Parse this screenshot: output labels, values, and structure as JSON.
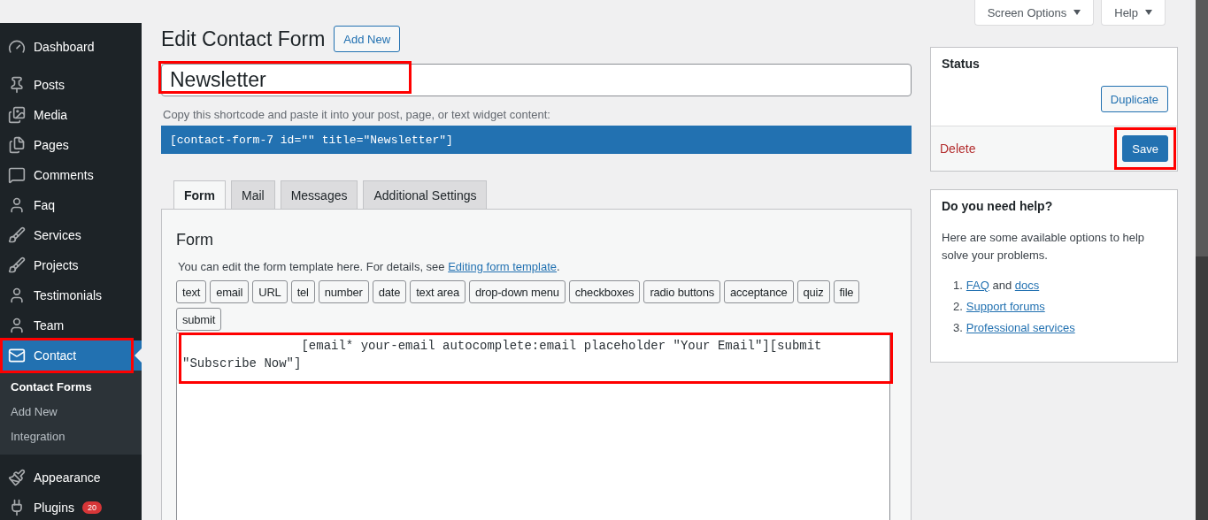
{
  "sidebar": {
    "menu_groups": [
      [
        {
          "label": "Dashboard",
          "selected": false
        }
      ],
      [
        {
          "label": "Posts",
          "selected": false
        },
        {
          "label": "Media",
          "selected": false
        },
        {
          "label": "Pages",
          "selected": false
        },
        {
          "label": "Comments",
          "selected": false
        },
        {
          "label": "Faq",
          "selected": false
        },
        {
          "label": "Services",
          "selected": false
        },
        {
          "label": "Projects",
          "selected": false
        },
        {
          "label": "Testimonials",
          "selected": false
        },
        {
          "label": "Team",
          "selected": false
        },
        {
          "label": "Contact",
          "selected": true,
          "highlighted": true,
          "submenu": [
            {
              "label": "Contact Forms",
              "selected": true
            },
            {
              "label": "Add New",
              "selected": false
            },
            {
              "label": "Integration",
              "selected": false
            }
          ]
        }
      ],
      [
        {
          "label": "Appearance",
          "selected": false
        },
        {
          "label": "Plugins",
          "selected": false,
          "badge": "20"
        }
      ]
    ]
  },
  "screen_meta": {
    "buttons": [
      "Screen Options",
      "Help"
    ]
  },
  "page_title": "Edit Contact Form",
  "add_new_button": "Add New",
  "title_field": {
    "value": "Newsletter",
    "highlighted": true
  },
  "shortcode": {
    "description": "Copy this shortcode and paste it into your post, page, or text widget content:",
    "code": "[contact-form-7 id=\"\" title=\"Newsletter\"]"
  },
  "tabs": [
    {
      "label": "Form",
      "selected": true
    },
    {
      "label": "Mail",
      "selected": false
    },
    {
      "label": "Messages",
      "selected": false
    },
    {
      "label": "Additional Settings",
      "selected": false
    }
  ],
  "form_panel": {
    "heading": "Form",
    "intro": "You can edit the form template here. For details, see ",
    "intro_link": "Editing form template",
    "intro_end": ".",
    "tag_buttons": [
      "text",
      "email",
      "URL",
      "tel",
      "number",
      "date",
      "text area",
      "drop-down menu",
      "checkboxes",
      "radio buttons",
      "acceptance",
      "quiz",
      "file",
      "submit"
    ],
    "template": {
      "value": "                [email* your-email autocomplete:email placeholder \"Your Email\"][submit \"Subscribe Now\"]",
      "highlighted": true
    }
  },
  "status_box": {
    "title": "Status",
    "duplicate_button": "Duplicate",
    "delete_link": "Delete",
    "save_button": {
      "label": "Save",
      "highlighted": true
    }
  },
  "help_box": {
    "title": "Do you need help?",
    "text": "Here are some available options to help solve your problems.",
    "items": [
      {
        "number": "1.",
        "parts": [
          {
            "kind": "link",
            "text": "FAQ"
          },
          {
            "kind": "text",
            "text": " and "
          },
          {
            "kind": "link",
            "text": "docs"
          }
        ]
      },
      {
        "number": "2.",
        "parts": [
          {
            "kind": "link",
            "text": "Support forums"
          }
        ]
      },
      {
        "number": "3.",
        "parts": [
          {
            "kind": "link",
            "text": "Professional services"
          }
        ]
      }
    ]
  }
}
